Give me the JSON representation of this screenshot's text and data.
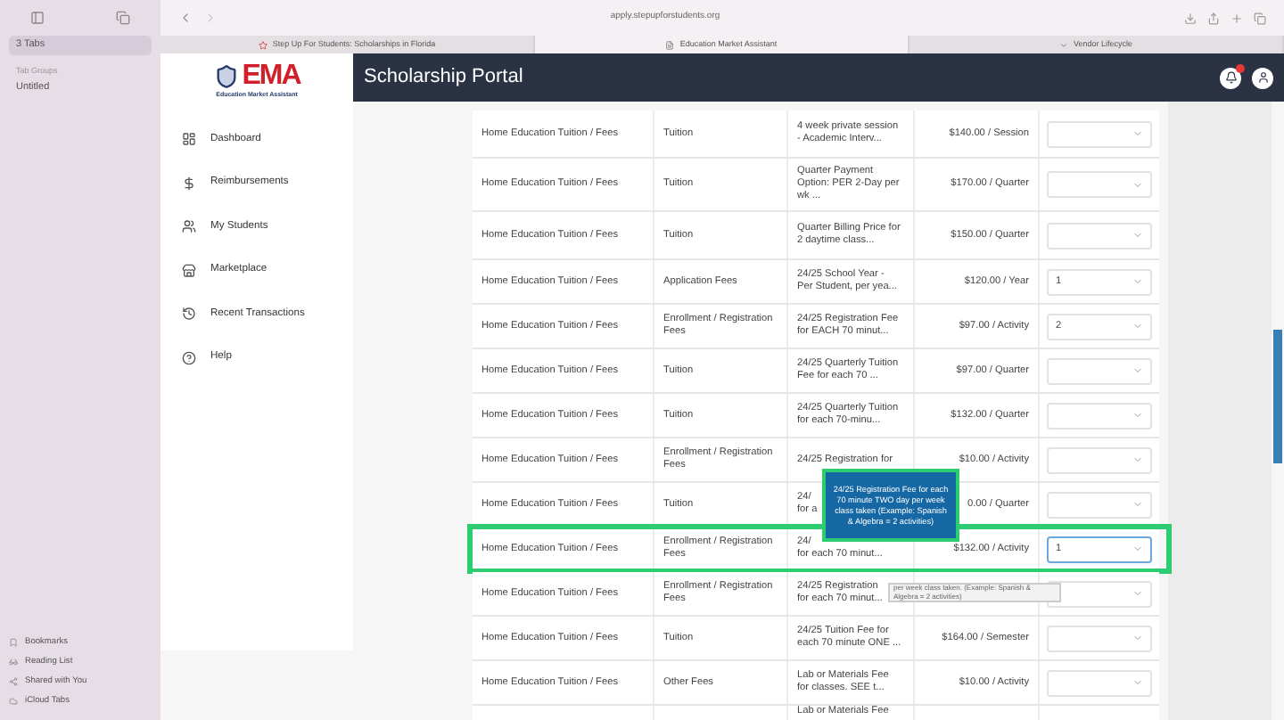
{
  "browser": {
    "sidebar": {
      "tabs": [
        {
          "label": "3 Tabs",
          "selected": true
        }
      ],
      "group_heading": "Tab Groups",
      "groups": [
        {
          "label": "Untitled",
          "selected": false
        }
      ],
      "bottom_items": [
        {
          "label": "Bookmarks",
          "kind": "bookmark"
        },
        {
          "label": "Reading List",
          "kind": "glasses"
        },
        {
          "label": "Shared with You",
          "kind": "shared"
        },
        {
          "label": "iCloud Tabs",
          "kind": "cloud"
        }
      ]
    },
    "address": "apply.stepupforstudents.org",
    "tabs": [
      {
        "label": "Step Up For Students: Scholarships in Florida",
        "selected": false,
        "kind": "star"
      },
      {
        "label": "Education Market Assistant",
        "selected": true,
        "kind": "doc"
      },
      {
        "label": "Vendor Lifecycle",
        "selected": false,
        "kind": "caret"
      }
    ]
  },
  "page": {
    "logo": {
      "text": "EMA",
      "subtitle": "Education Market Assistant"
    },
    "title": "Scholarship Portal",
    "nav": [
      {
        "label": "Dashboard",
        "kind": "dashboard"
      },
      {
        "label": "Reimbursements",
        "kind": "dollar"
      },
      {
        "label": "My Students",
        "kind": "students"
      },
      {
        "label": "Marketplace",
        "kind": "store"
      },
      {
        "label": "Recent Transactions",
        "kind": "history"
      },
      {
        "label": "Help",
        "kind": "help"
      }
    ],
    "rows": [
      {
        "category": "Home Education Tuition / Fees",
        "type": "Tuition",
        "description": [
          "4 week private session",
          "- Academic Interv..."
        ],
        "price": "$140.00 / Session",
        "select": {
          "focused": false
        },
        "highlighted": false
      },
      {
        "category": "Home Education Tuition / Fees",
        "type": "Tuition",
        "description": [
          "Quarter Payment",
          "Option: PER 2-Day per",
          "wk ..."
        ],
        "price": "$170.00 / Quarter",
        "select": {
          "focused": false
        },
        "highlighted": false
      },
      {
        "category": "Home Education Tuition / Fees",
        "type": "Tuition",
        "description": [
          "Quarter Billing Price for",
          "2 daytime class..."
        ],
        "price": "$150.00 / Quarter",
        "select": {
          "focused": false
        },
        "highlighted": false
      },
      {
        "category": "Home Education Tuition / Fees",
        "type": "Application Fees",
        "description": [
          "24/25 School Year -",
          "Per Student, per yea..."
        ],
        "price": "$120.00 / Year",
        "select": {
          "value": "1",
          "focused": false
        },
        "highlighted": false
      },
      {
        "category": "Home Education Tuition / Fees",
        "type": "Enrollment / Registration Fees",
        "description": [
          "24/25 Registration Fee",
          "for EACH 70 minut..."
        ],
        "price": "$97.00 / Activity",
        "select": {
          "value": "2",
          "focused": false
        },
        "highlighted": false
      },
      {
        "category": "Home Education Tuition / Fees",
        "type": "Tuition",
        "description": [
          "24/25 Quarterly Tuition",
          "Fee for each 70 ..."
        ],
        "price": "$97.00 / Quarter",
        "select": {
          "focused": false
        },
        "highlighted": false
      },
      {
        "category": "Home Education Tuition / Fees",
        "type": "Tuition",
        "description": [
          "24/25 Quarterly Tuition",
          "for each 70-minu..."
        ],
        "price": "$132.00 / Quarter",
        "select": {
          "focused": false
        },
        "highlighted": false
      },
      {
        "category": "Home Education Tuition / Fees",
        "type": "Enrollment / Registration Fees",
        "description": [
          "24/25 Registration for"
        ],
        "price": "$10.00 / Activity",
        "select": {
          "focused": false
        },
        "highlighted": false
      },
      {
        "category": "Home Education Tuition / Fees",
        "type": "Tuition",
        "description": [
          "24/",
          "for a"
        ],
        "price": "0.00 / Quarter",
        "select": {
          "focused": false
        },
        "highlighted": false
      },
      {
        "category": "Home Education Tuition / Fees",
        "type": "Enrollment / Registration Fees",
        "description": [
          "24/",
          "for each 70 minut..."
        ],
        "price": "$132.00 / Activity",
        "select": {
          "value": "1",
          "focused": true
        },
        "highlighted": true
      },
      {
        "category": "Home Education Tuition / Fees",
        "type": "Enrollment / Registration Fees",
        "description": [
          "24/25 Registration",
          "for each 70 minut..."
        ],
        "select": {
          "focused": false
        },
        "highlighted": false
      },
      {
        "category": "Home Education Tuition / Fees",
        "type": "Tuition",
        "description": [
          "24/25 Tuition Fee for",
          "each 70 minute ONE ..."
        ],
        "price": "$164.00 / Semester",
        "select": {
          "focused": false
        },
        "highlighted": false
      },
      {
        "category": "Home Education Tuition / Fees",
        "type": "Other Fees",
        "description": [
          "Lab or Materials Fee",
          "for classes. SEE t..."
        ],
        "price": "$10.00 / Activity",
        "select": {
          "focused": false
        },
        "highlighted": false
      },
      {
        "description": [
          "Lab or Materials Fee"
        ],
        "highlighted": false
      }
    ],
    "tooltip": "24/25 Registration Fee for each 70 minute TWO day per week class taken (Example: Spanish & Algebra = 2 activities)",
    "hover_tooltip": "per week class taken. (Example: Spanish & Algebra = 2 activities)"
  }
}
